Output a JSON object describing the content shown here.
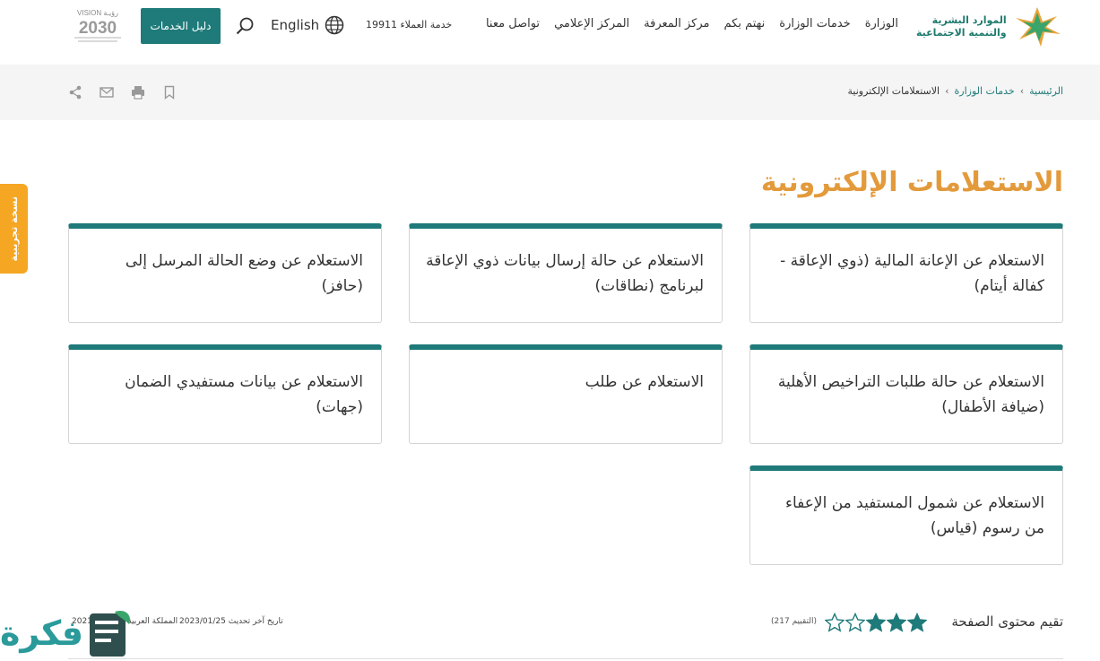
{
  "header": {
    "logo_line1": "الموارد البشرية",
    "logo_line2": "والتنمية الاجتماعية",
    "nav": [
      "الوزارة",
      "خدمات الوزارة",
      "نهتم بكم",
      "مركز المعرفة",
      "المركز الإعلامي",
      "تواصل معنا"
    ],
    "customer_service": "خدمة العملاء 19911",
    "language": "English",
    "services_button": "دليل الخدمات",
    "vision_top": "VISION رؤيـة",
    "vision_year": "2030"
  },
  "breadcrumb": {
    "home": "الرئيسية",
    "services": "خدمات الوزارة",
    "current": "الاستعلامات الإلكترونية"
  },
  "side_tab": "نسخة تجريبية",
  "page_title": "الاستعلامات الإلكترونية",
  "cards": [
    "الاستعلام عن الإعانة المالية (ذوي الإعاقة - كفالة أيتام)",
    "الاستعلام عن حالة إرسال بيانات ذوي الإعاقة لبرنامج (نطاقات)",
    "الاستعلام عن وضع الحالة المرسل إلى (حافز)",
    "الاستعلام عن حالة طلبات التراخيص الأهلية (ضيافة الأطفال)",
    "الاستعلام عن طلب",
    "الاستعلام عن بيانات مستفيدي الضمان (جهات)",
    "الاستعلام عن شمول المستفيد من الإعفاء من رسوم (قياس)"
  ],
  "footer": {
    "rating_label": "تقيم محتوى الصفحة",
    "rating_value": 3,
    "rating_max": 5,
    "rating_count": "(التقييم 217)",
    "last_updated": "تاريخ آخر تحديث  2023/01/25",
    "copyright": "المملكة العربية السعودية 2021"
  },
  "watermark": "فكرة",
  "colors": {
    "primary": "#1f7a7a",
    "title": "#e39a3b",
    "side_tab": "#f5a623"
  }
}
